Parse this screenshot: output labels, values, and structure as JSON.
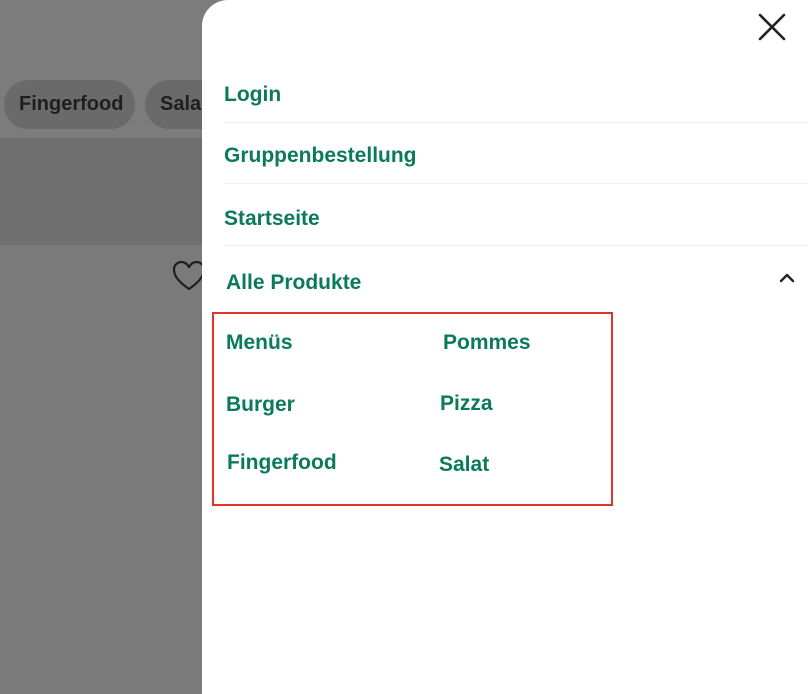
{
  "background": {
    "chips": [
      "Fingerfood",
      "Sala"
    ]
  },
  "drawer": {
    "close_icon": "close-icon",
    "menu": {
      "login": "Login",
      "group_order": "Gruppenbestellung",
      "home": "Startseite",
      "all_products": "Alle Produkte"
    },
    "expanded_icon": "chevron-up-icon",
    "subcategories": [
      "Menüs",
      "Pommes",
      "Burger",
      "Pizza",
      "Fingerfood",
      "Salat"
    ],
    "accent_color": "#0a7a5a",
    "highlight_color": "#e53228"
  }
}
